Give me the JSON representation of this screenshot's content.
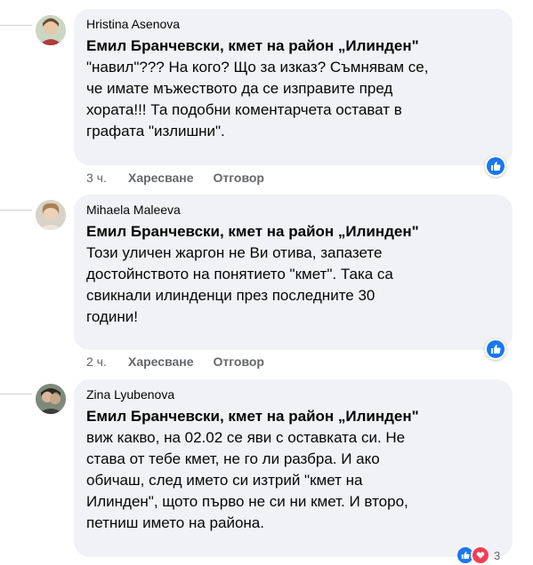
{
  "comments": [
    {
      "author": "Hristina Asenova",
      "mention": "Емил Бранчевски, кмет на район „Илинден\"",
      "lines": [
        "\"навил\"??? На кого? Що за изказ? Съмнявам се,",
        "че имате мъжеството да се изправите пред",
        "хората!!! Та подобни коментарчета остават в",
        "графата \"излишни\"."
      ],
      "time": "3 ч.",
      "like_label": "Харесване",
      "reply_label": "Отговор",
      "reaction": "like-icon"
    },
    {
      "author": "Mihaela Maleeva",
      "mention": "Емил Бранчевски, кмет на район „Илинден\"",
      "lines": [
        "Този уличен жаргон не Ви отива, запазете",
        "достойнството на понятието \"кмет\". Така са",
        "свикнали илинденци през последните 30",
        "години!"
      ],
      "time": "2 ч.",
      "like_label": "Харесване",
      "reply_label": "Отговор",
      "reaction": "like-icon"
    },
    {
      "author": "Zina Lyubenova",
      "mention": "Емил Бранчевски, кмет на район „Илинден\"",
      "lines": [
        "виж какво, на 02.02 се яви с оставката си. Не",
        "става от тебе кмет, не го ли разбра. И ако",
        "обичаш, след името си изтрий \"кмет на",
        "Илинден\", щото първо не си ни кмет. И второ,",
        "петниш името на района."
      ],
      "reactions": [
        "like-icon",
        "love-icon"
      ],
      "reaction_count": "3"
    }
  ],
  "colors": {
    "bubble": "#f0f2f5",
    "meta": "#65676b",
    "like": "#1877f2",
    "love": "#f33e58"
  }
}
